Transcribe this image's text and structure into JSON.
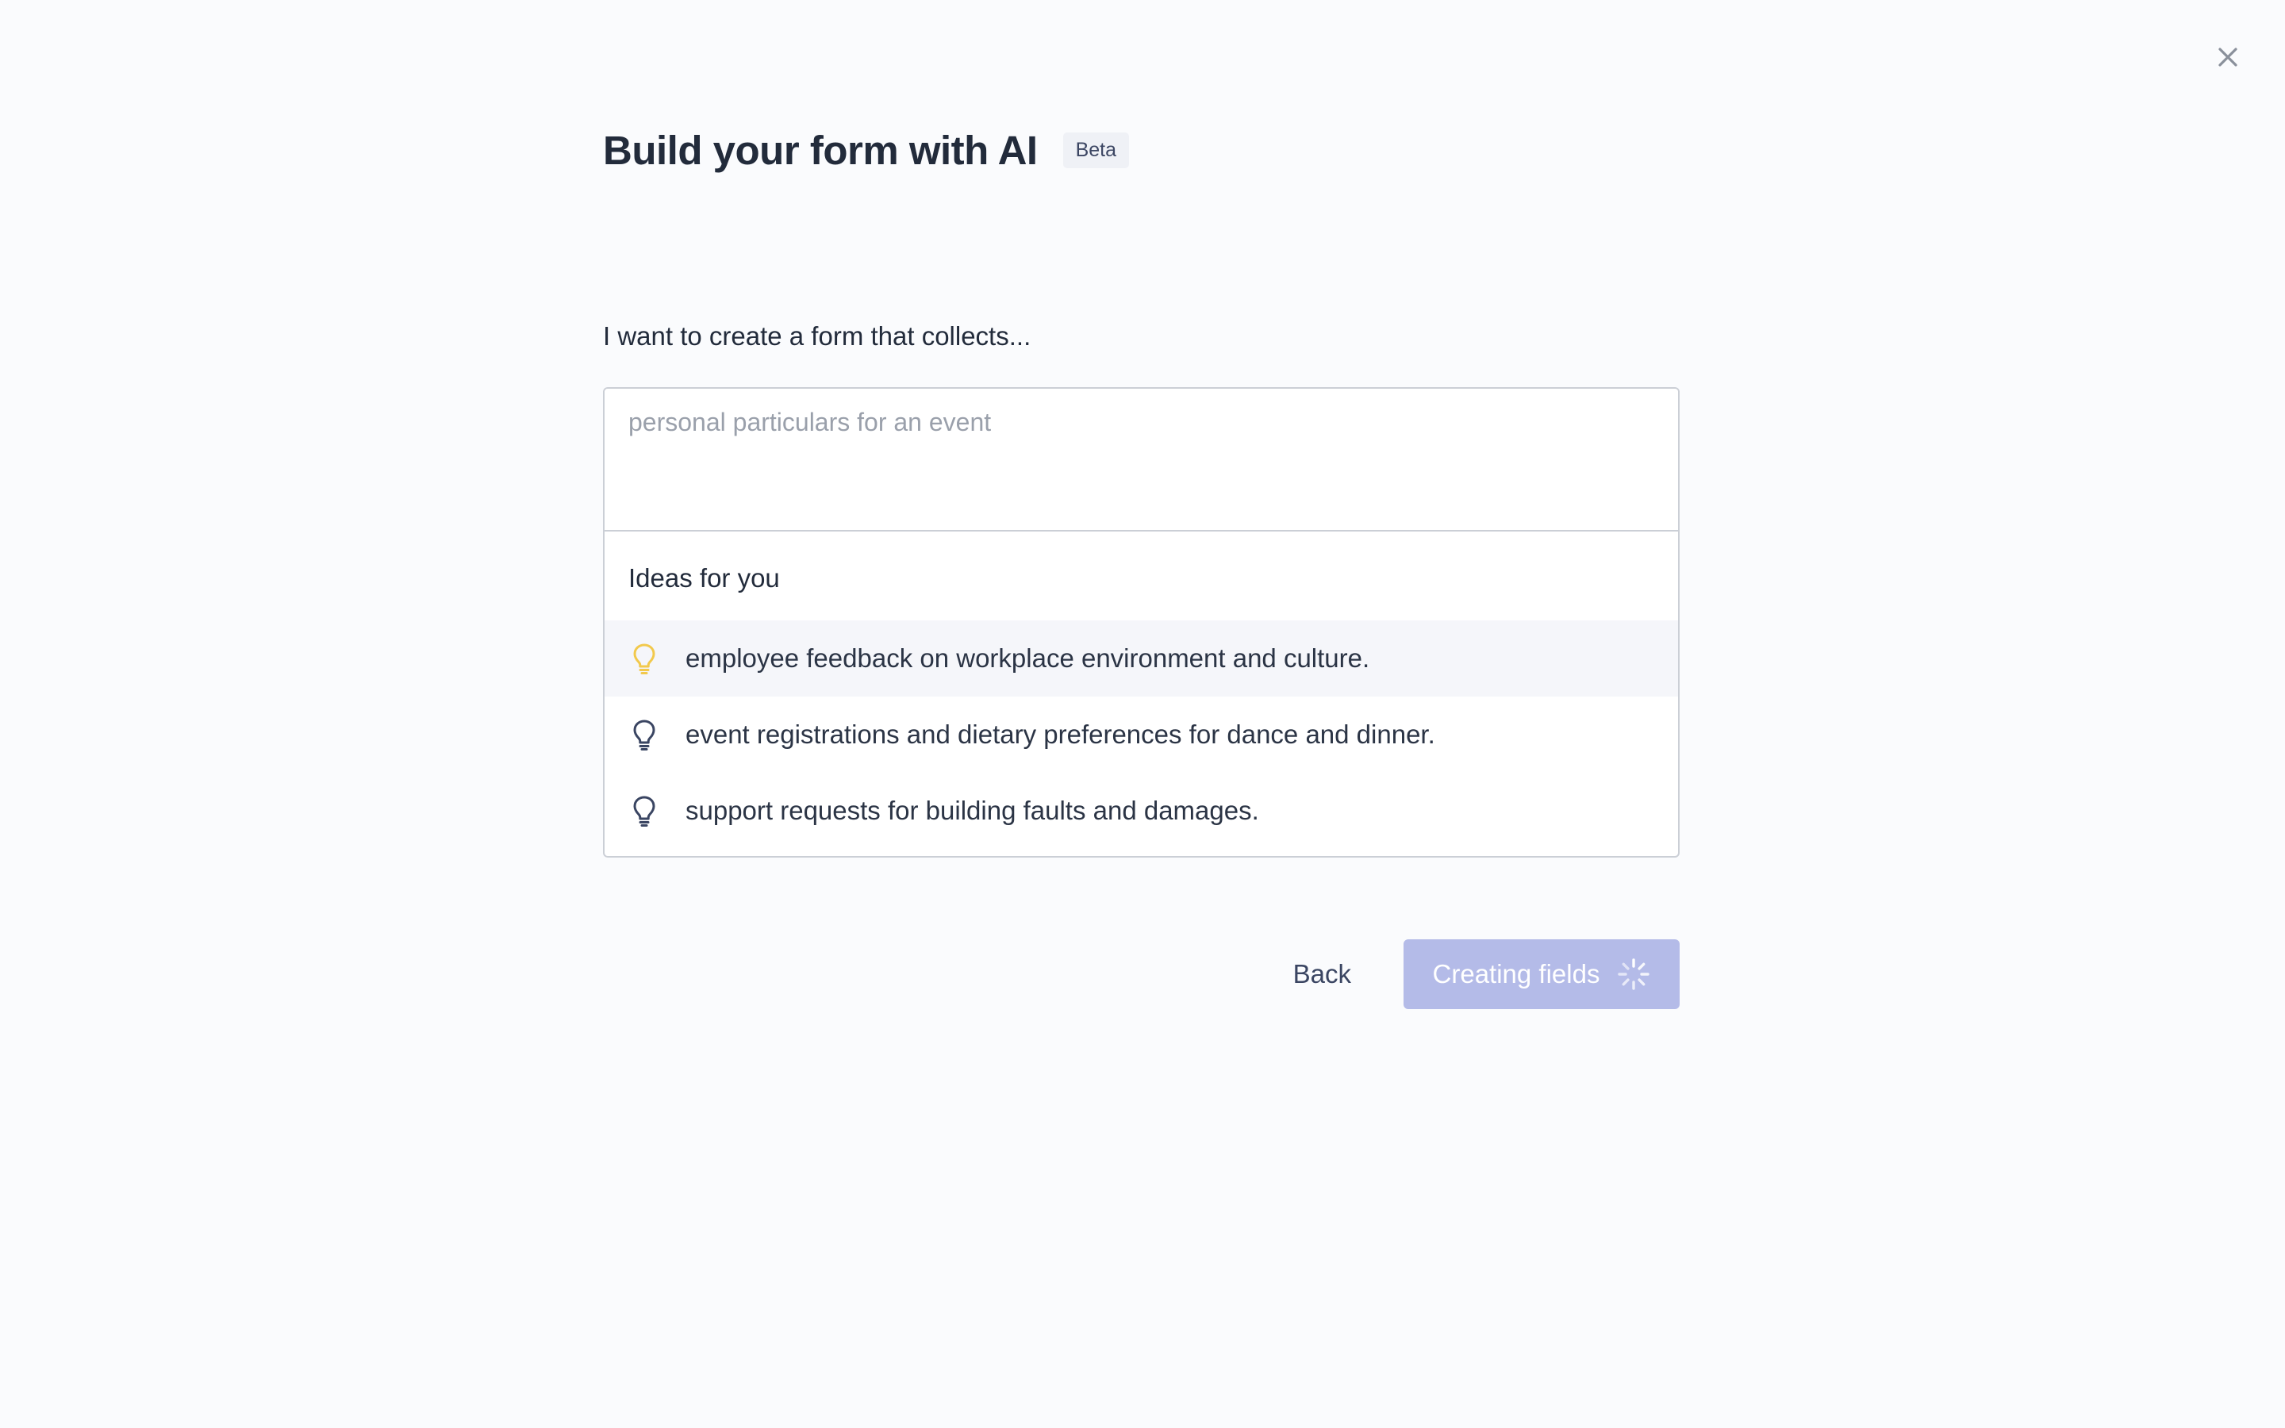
{
  "header": {
    "title": "Build your form with AI",
    "badge": "Beta"
  },
  "prompt": {
    "label": "I want to create a form that collects...",
    "value": "",
    "placeholder": "personal particulars for an event"
  },
  "ideas": {
    "heading": "Ideas for you",
    "items": [
      {
        "text": "employee feedback on workplace environment and culture.",
        "highlighted": true
      },
      {
        "text": "event registrations and dietary preferences for dance and dinner.",
        "highlighted": false
      },
      {
        "text": "support requests for building faults and damages.",
        "highlighted": false
      }
    ]
  },
  "actions": {
    "back_label": "Back",
    "primary_label": "Creating fields",
    "primary_state": "loading"
  },
  "icons": {
    "close": "close-icon",
    "idea": "lightbulb-icon",
    "loading": "spinner-icon"
  },
  "colors": {
    "background": "#fafbfd",
    "primary_disabled": "#b4bbe8",
    "highlight_bulb": "#f2c94c",
    "bulb": "#3a4562"
  }
}
